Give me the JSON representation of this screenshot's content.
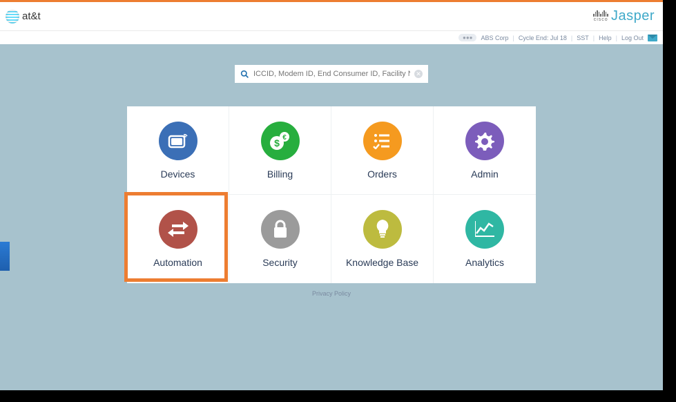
{
  "header": {
    "brand": "at&t",
    "cobrand_small": "cisco",
    "cobrand": "Jasper"
  },
  "subheader": {
    "badge": "●●●",
    "org": "ABS Corp",
    "cycle": "Cycle End: Jul 18",
    "tz": "SST",
    "help": "Help",
    "logout": "Log Out"
  },
  "search": {
    "placeholder": "ICCID, Modem ID, End Consumer ID, Facility Name, O"
  },
  "tiles": [
    {
      "label": "Devices",
      "color": "c-blue"
    },
    {
      "label": "Billing",
      "color": "c-green"
    },
    {
      "label": "Orders",
      "color": "c-orange"
    },
    {
      "label": "Admin",
      "color": "c-purple"
    },
    {
      "label": "Automation",
      "color": "c-brick"
    },
    {
      "label": "Security",
      "color": "c-grey"
    },
    {
      "label": "Knowledge Base",
      "color": "c-olive"
    },
    {
      "label": "Analytics",
      "color": "c-teal"
    }
  ],
  "footer": {
    "privacy": "Privacy Policy"
  },
  "highlight_tile_index": 4
}
